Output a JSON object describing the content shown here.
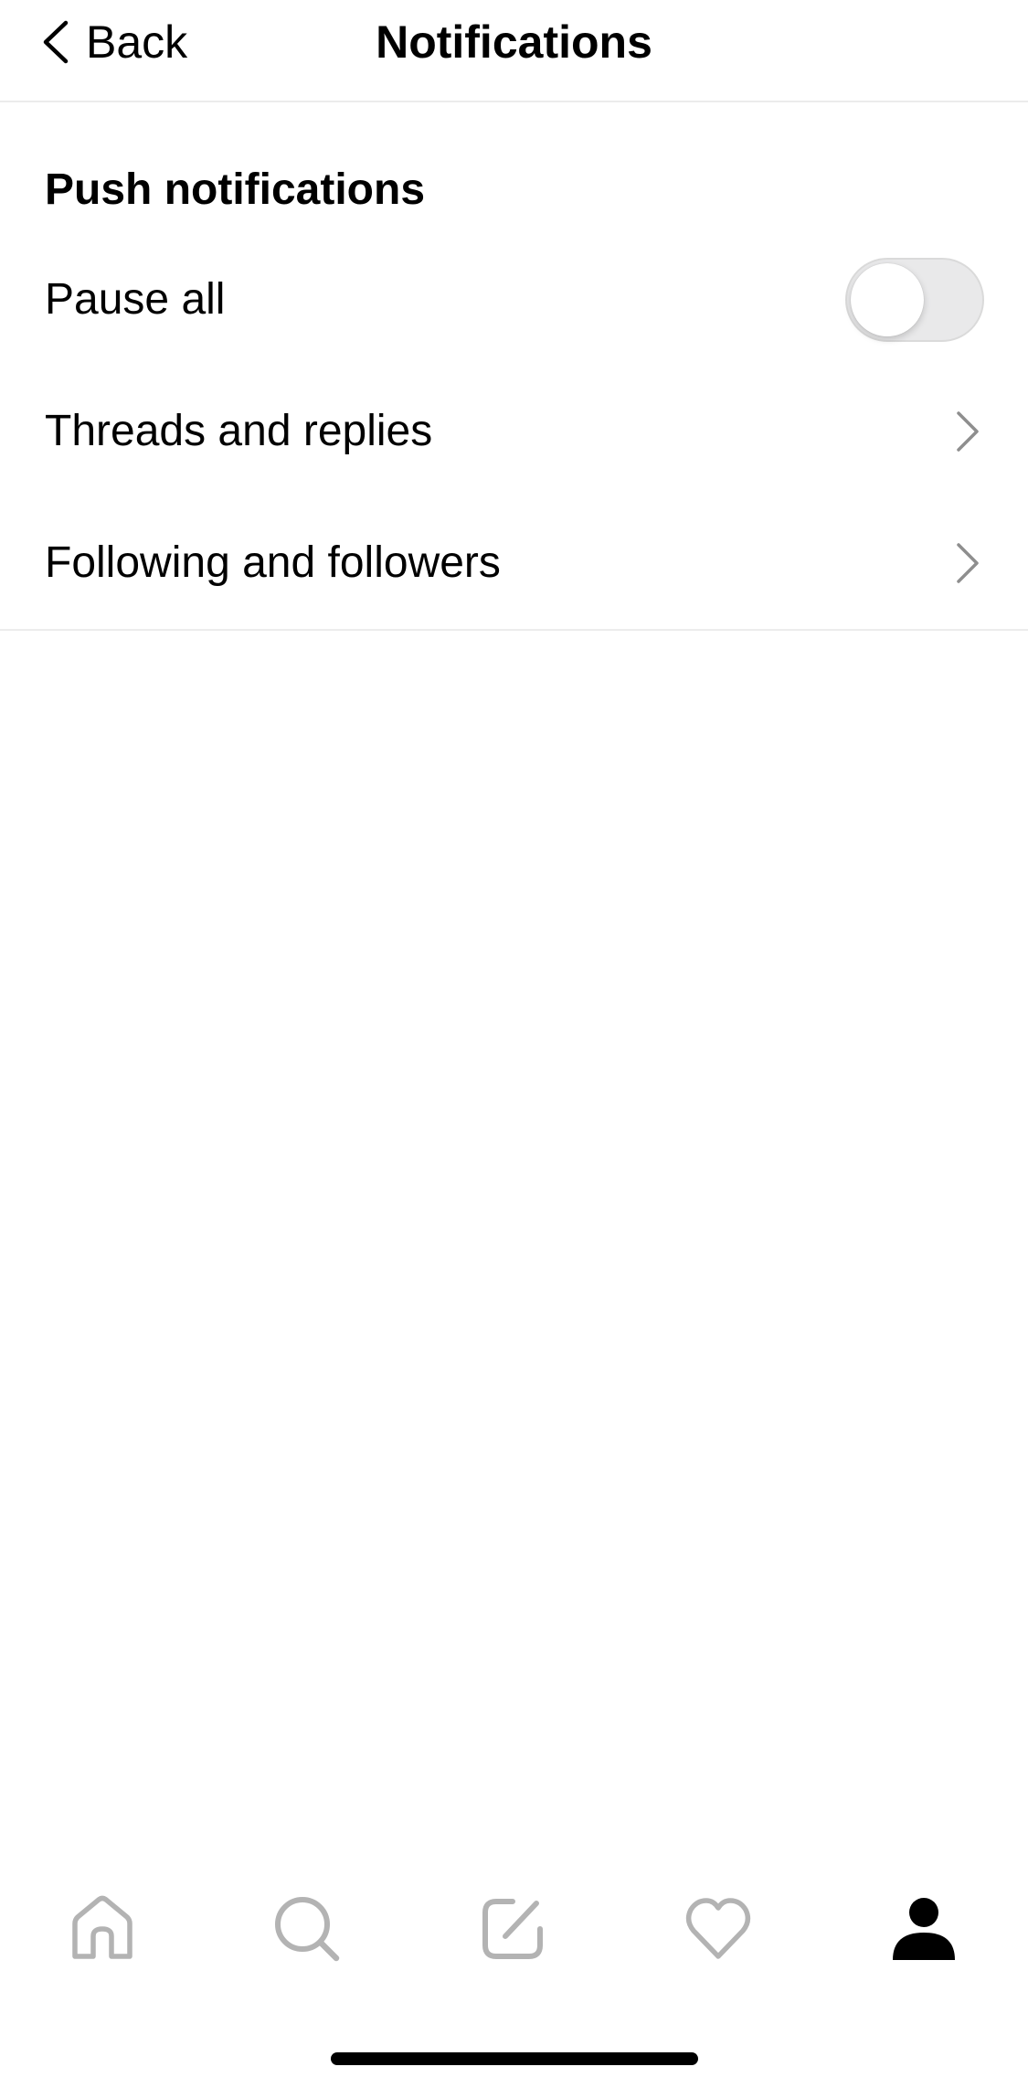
{
  "header": {
    "back_label": "Back",
    "title": "Notifications"
  },
  "section": {
    "title": "Push notifications"
  },
  "settings": [
    {
      "label": "Pause all",
      "control": "toggle",
      "enabled": false
    },
    {
      "label": "Threads and replies",
      "control": "chevron-right-icon"
    },
    {
      "label": "Following and followers",
      "control": "chevron-right-icon"
    }
  ],
  "tab_bar": {
    "items": [
      {
        "icon": "home-icon",
        "active": false
      },
      {
        "icon": "search-icon",
        "active": false
      },
      {
        "icon": "compose-icon",
        "active": false
      },
      {
        "icon": "heart-icon",
        "active": false
      },
      {
        "icon": "profile-icon",
        "active": true
      }
    ]
  },
  "colors": {
    "text": "#000000",
    "divider": "#ececec",
    "toggle_off": "#e9e9ea",
    "inactive_icon": "#b3b3b3",
    "active_icon": "#000000"
  }
}
